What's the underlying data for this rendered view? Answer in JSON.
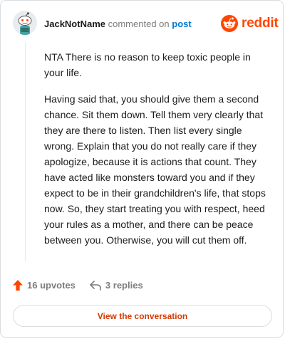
{
  "header": {
    "username": "JackNotName",
    "commented_text": "commented on",
    "post_link": "post"
  },
  "brand": {
    "name": "reddit",
    "icon": "snoo-icon",
    "color": "#ff4500"
  },
  "comment": {
    "paragraphs": [
      "NTA There is no reason to keep toxic people in your life.",
      "Having said that, you should give them a second chance. Sit them down. Tell them very clearly that they are there to listen. Then list every single wrong. Explain that you do not really care if they apologize, because it is actions that count. They have acted like monsters toward you and if they expect to be in their grandchildren's life, that stops now. So, they start treating you with respect, heed your rules as a mother, and there can be peace between you. Otherwise, you will cut them off."
    ]
  },
  "actions": {
    "upvotes": "16 upvotes",
    "upvote_icon": "upvote-arrow-icon",
    "replies": "3 replies",
    "reply_icon": "reply-arrow-icon"
  },
  "footer": {
    "button_label": "View the conversation"
  }
}
